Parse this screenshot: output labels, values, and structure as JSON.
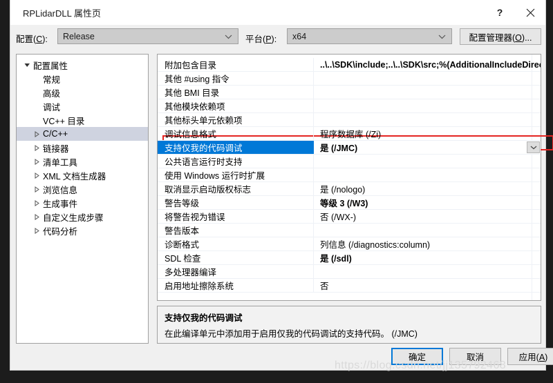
{
  "window": {
    "title": "RPLidarDLL 属性页",
    "help_icon": "question-mark-icon",
    "close_icon": "close-icon"
  },
  "config_bar": {
    "configuration_label": "配置(C):",
    "configuration_label_plain": "配置",
    "configuration_accel": "C",
    "configuration_value": "Release",
    "platform_label": "平台(P):",
    "platform_label_plain": "平台",
    "platform_accel": "P",
    "platform_value": "x64",
    "config_manager_button": "配置管理器(O)...",
    "config_manager_plain_pre": "配置管理器(",
    "config_manager_accel": "O",
    "config_manager_plain_post": ")..."
  },
  "tree": {
    "items": [
      {
        "label": "配置属性",
        "indent": 0,
        "arrow": "expanded",
        "selected": false
      },
      {
        "label": "常规",
        "indent": 1,
        "arrow": "none",
        "selected": false
      },
      {
        "label": "高级",
        "indent": 1,
        "arrow": "none",
        "selected": false
      },
      {
        "label": "调试",
        "indent": 1,
        "arrow": "none",
        "selected": false
      },
      {
        "label": "VC++ 目录",
        "indent": 1,
        "arrow": "none",
        "selected": false
      },
      {
        "label": "C/C++",
        "indent": 1,
        "arrow": "collapsed",
        "selected": true
      },
      {
        "label": "链接器",
        "indent": 1,
        "arrow": "collapsed",
        "selected": false
      },
      {
        "label": "清单工具",
        "indent": 1,
        "arrow": "collapsed",
        "selected": false
      },
      {
        "label": "XML 文档生成器",
        "indent": 1,
        "arrow": "collapsed",
        "selected": false
      },
      {
        "label": "浏览信息",
        "indent": 1,
        "arrow": "collapsed",
        "selected": false
      },
      {
        "label": "生成事件",
        "indent": 1,
        "arrow": "collapsed",
        "selected": false
      },
      {
        "label": "自定义生成步骤",
        "indent": 1,
        "arrow": "collapsed",
        "selected": false
      },
      {
        "label": "代码分析",
        "indent": 1,
        "arrow": "collapsed",
        "selected": false
      }
    ]
  },
  "grid": {
    "rows": [
      {
        "name": "附加包含目录",
        "value": "..\\..\\SDK\\include;..\\..\\SDK\\src;%(AdditionalIncludeDirec",
        "bold": true,
        "selected": false,
        "dropdown": false
      },
      {
        "name": "其他 #using 指令",
        "value": "",
        "bold": false,
        "selected": false,
        "dropdown": false
      },
      {
        "name": "其他 BMI 目录",
        "value": "",
        "bold": false,
        "selected": false,
        "dropdown": false
      },
      {
        "name": "其他模块依赖项",
        "value": "",
        "bold": false,
        "selected": false,
        "dropdown": false
      },
      {
        "name": "其他标头单元依赖项",
        "value": "",
        "bold": false,
        "selected": false,
        "dropdown": false
      },
      {
        "name": "调试信息格式",
        "value": "程序数据库 (/Zi)",
        "bold": false,
        "selected": false,
        "dropdown": false
      },
      {
        "name": "支持仅我的代码调试",
        "value": "是 (/JMC)",
        "bold": true,
        "selected": true,
        "dropdown": true
      },
      {
        "name": "公共语言运行时支持",
        "value": "",
        "bold": false,
        "selected": false,
        "dropdown": false
      },
      {
        "name": "使用 Windows 运行时扩展",
        "value": "",
        "bold": false,
        "selected": false,
        "dropdown": false
      },
      {
        "name": "取消显示启动版权标志",
        "value": "是 (/nologo)",
        "bold": false,
        "selected": false,
        "dropdown": false
      },
      {
        "name": "警告等级",
        "value": "等级 3 (/W3)",
        "bold": true,
        "selected": false,
        "dropdown": false
      },
      {
        "name": "将警告视为错误",
        "value": "否 (/WX-)",
        "bold": false,
        "selected": false,
        "dropdown": false
      },
      {
        "name": "警告版本",
        "value": "",
        "bold": false,
        "selected": false,
        "dropdown": false
      },
      {
        "name": "诊断格式",
        "value": "列信息 (/diagnostics:column)",
        "bold": false,
        "selected": false,
        "dropdown": false
      },
      {
        "name": "SDL 检查",
        "value": "是 (/sdl)",
        "bold": true,
        "selected": false,
        "dropdown": false
      },
      {
        "name": "多处理器编译",
        "value": "",
        "bold": false,
        "selected": false,
        "dropdown": false
      },
      {
        "name": "启用地址擦除系统",
        "value": "否",
        "bold": false,
        "selected": false,
        "dropdown": false
      }
    ]
  },
  "description": {
    "title": "支持仅我的代码调试",
    "text": "在此编译单元中添加用于启用仅我的代码调试的支持代码。 (/JMC)"
  },
  "footer": {
    "ok": "确定",
    "cancel": "取消",
    "apply": "应用(A)",
    "apply_plain_pre": "应用(",
    "apply_accel": "A",
    "apply_plain_post": ")"
  },
  "watermark": {
    "text": "https://blog.csdn.net/jj135792468"
  },
  "colors": {
    "accent": "#0078d7",
    "annotation": "#e52421",
    "tree_selection": "#cfd3e0"
  }
}
